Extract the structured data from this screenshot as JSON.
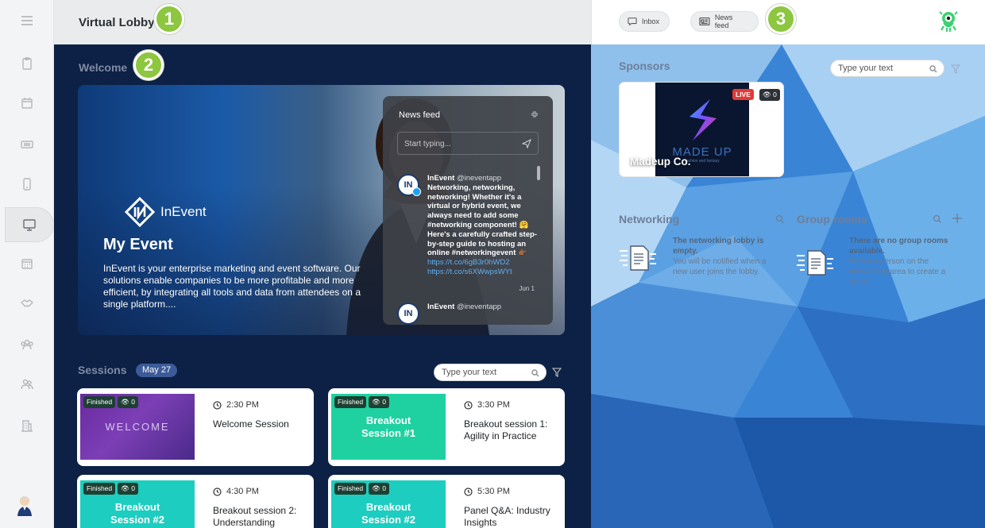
{
  "header": {
    "title": "Virtual Lobby",
    "inbox_label": "Inbox",
    "newsfeed_label": "News feed"
  },
  "callouts": {
    "one": "1",
    "two": "2",
    "three": "3"
  },
  "welcome": {
    "label": "Welcome",
    "logo_text": "InEvent",
    "event_title": "My Event",
    "event_description": "InEvent is your enterprise marketing and event software. Our solutions enable companies to be more profitable and more efficient, by integrating all tools and data from attendees on a single platform...."
  },
  "newsfeed": {
    "title": "News feed",
    "input_placeholder": "Start typing...",
    "tweets": [
      {
        "author": "InEvent",
        "handle": "@ineventapp",
        "text": "Networking, networking, networking! Whether it's a virtual or hybrid event, we always need to add some #networking component! 🤗 Here's a carefully crafted step-by-step guide to hosting an online #networkingevent 👉🏾",
        "link1": "https://t.co/6gB3r0hWD2",
        "link2": "https://t.co/s6XWwpsWYt",
        "date": "Jun 1"
      },
      {
        "author": "InEvent",
        "handle": "@ineventapp"
      }
    ]
  },
  "sessions": {
    "label": "Sessions",
    "date_badge": "May 27",
    "search_placeholder": "Type your text",
    "items": [
      {
        "status": "Finished",
        "views": "0",
        "thumb_text": "WELCOME",
        "time": "2:30 PM",
        "title": "Welcome Session"
      },
      {
        "status": "Finished",
        "views": "0",
        "thumb_text": "Breakout Session #1",
        "time": "3:30 PM",
        "title": "Breakout session 1: Agility in Practice"
      },
      {
        "status": "Finished",
        "views": "0",
        "thumb_text": "Breakout Session #2",
        "time": "4:30 PM",
        "title": "Breakout session 2: Understanding"
      },
      {
        "status": "Finished",
        "views": "0",
        "thumb_text": "Breakout Session #2",
        "time": "5:30 PM",
        "title": "Panel Q&A: Industry Insights"
      }
    ]
  },
  "sponsors": {
    "label": "Sponsors",
    "search_placeholder": "Type your text",
    "items": [
      {
        "name": "Madeup Co.",
        "live_badge": "LIVE",
        "views": "0",
        "logo_text": "MADE UP",
        "logo_subtext": "fashion and fantasy"
      }
    ]
  },
  "networking": {
    "label": "Networking",
    "empty_title": "The networking lobby is empty.",
    "empty_text": "You will be notified when a new user joins the lobby."
  },
  "group_rooms": {
    "label": "Group rooms",
    "empty_title": "There are no group rooms available.",
    "empty_text": "Select a person on the networking area to create a room."
  },
  "colors": {
    "accent_green": "#8dc63f",
    "main_bg": "#0c2145",
    "live_red": "#e53935"
  },
  "icons": {
    "rail": [
      "menu-icon",
      "clipboard-icon",
      "calendar-icon",
      "ticket-icon",
      "phone-icon",
      "monitor-icon",
      "calendar-grid-icon",
      "handshake-icon",
      "group-icon",
      "users-icon",
      "building-icon"
    ]
  }
}
